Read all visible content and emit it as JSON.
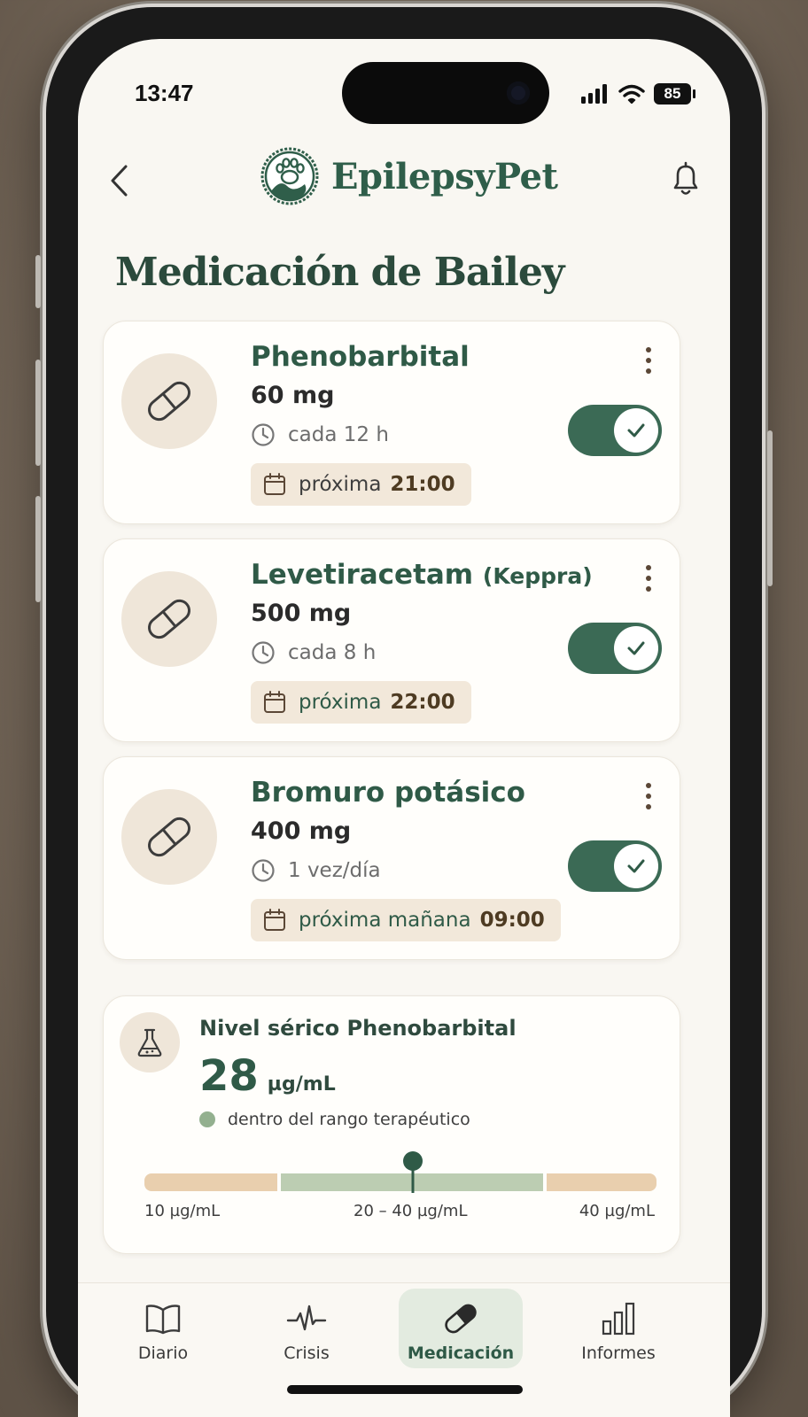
{
  "status_bar": {
    "time": "13:47",
    "battery": "85"
  },
  "header": {
    "app_name": "EpilepsyPet"
  },
  "page": {
    "title": "Medicación de Bailey"
  },
  "medications": [
    {
      "name": "Phenobarbital",
      "alt_name": "",
      "dose": "60 mg",
      "frequency": "cada 12 h",
      "next_label": "próxima",
      "next_time": "21:00",
      "enabled": true
    },
    {
      "name": "Levetiracetam",
      "alt_name": "(Keppra)",
      "dose": "500 mg",
      "frequency": "cada 8 h",
      "next_label": "próxima",
      "next_time": "22:00",
      "enabled": true
    },
    {
      "name": "Bromuro potásico",
      "alt_name": "",
      "dose": "400 mg",
      "frequency": "1 vez/día",
      "next_label": "próxima mañana",
      "next_time": "09:00",
      "enabled": true
    }
  ],
  "serum": {
    "title": "Nivel sérico Phenobarbital",
    "value": "28",
    "unit": "µg/mL",
    "status": "dentro del rango terapéutico",
    "range_labels": {
      "low": "10 µg/mL",
      "mid": "20 – 40 µg/mL",
      "high": "40 µg/mL"
    }
  },
  "tabs": [
    {
      "label": "Diario",
      "icon": "book-icon",
      "active": false
    },
    {
      "label": "Crisis",
      "icon": "heartbeat-icon",
      "active": false
    },
    {
      "label": "Medicación",
      "icon": "pill-icon",
      "active": true
    },
    {
      "label": "Informes",
      "icon": "bar-chart-icon",
      "active": false
    }
  ],
  "colors": {
    "primary": "#2f5a47",
    "accent_bg": "#efe6d9",
    "screen_bg": "#f9f7f2"
  }
}
